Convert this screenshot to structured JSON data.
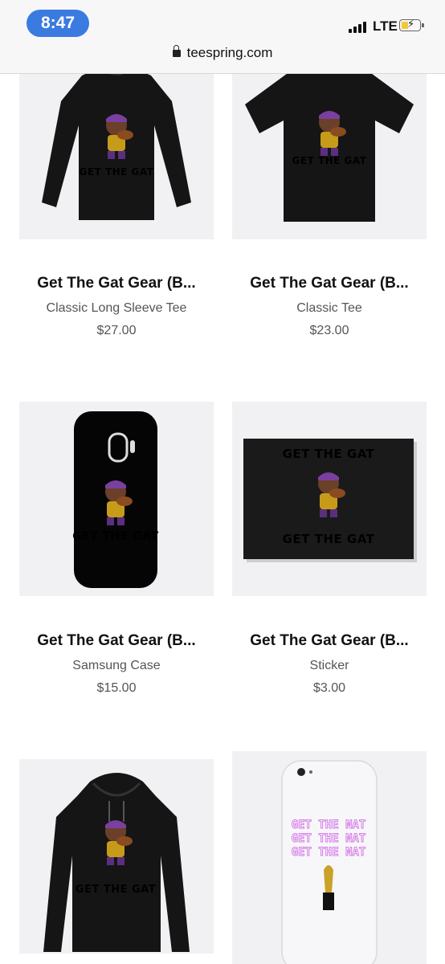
{
  "status_bar": {
    "time": "8:47",
    "network": "LTE"
  },
  "browser": {
    "url": "teespring.com"
  },
  "products": [
    {
      "name": "Get The Gat Gear (B...",
      "type": "Classic Long Sleeve Tee",
      "price": "$27.00",
      "print_text": "GET THE GAT",
      "icon": "long-sleeve-shirt"
    },
    {
      "name": "Get The Gat Gear (B...",
      "type": "Classic Tee",
      "price": "$23.00",
      "print_text": "GET THE GAT",
      "icon": "t-shirt"
    },
    {
      "name": "Get The Gat Gear (B...",
      "type": "Samsung Case",
      "price": "$15.00",
      "print_text": "GET THE GAT",
      "icon": "phone-case"
    },
    {
      "name": "Get The Gat Gear (B...",
      "type": "Sticker",
      "price": "$3.00",
      "print_text": "GET THE GAT",
      "icon": "sticker"
    },
    {
      "name": "",
      "type": "",
      "price": "",
      "print_text": "GET THE GAT",
      "icon": "hoodie"
    },
    {
      "name": "",
      "type": "",
      "price": "",
      "print_text": "GET THE NAT",
      "icon": "phone-case"
    }
  ],
  "colors": {
    "print_orange": "#e08a1e",
    "print_pink": "#d77ee8",
    "time_pill": "#3a7be0"
  }
}
